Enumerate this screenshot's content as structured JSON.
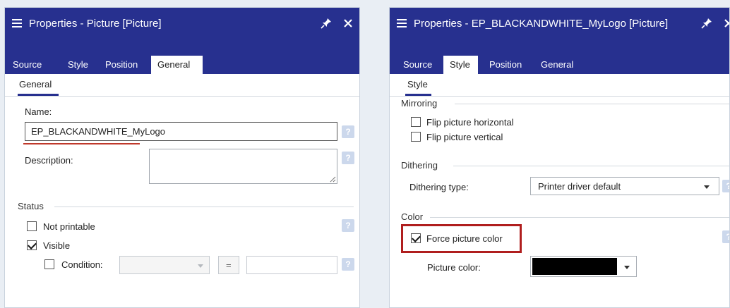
{
  "left_panel": {
    "title": "Properties - Picture [Picture]",
    "tabs": [
      "Source",
      "Style",
      "Position",
      "General"
    ],
    "active_tab": "General",
    "subtab": "General",
    "name_label": "Name:",
    "name_value": "EP_BLACKANDWHITE_MyLogo",
    "description_label": "Description:",
    "description_value": "",
    "status_section": "Status",
    "not_printable_label": "Not printable",
    "visible_label": "Visible",
    "condition_label": "Condition:",
    "condition_operator": "=",
    "condition_value": "",
    "help_glyph": "?"
  },
  "right_panel": {
    "title": "Properties - EP_BLACKANDWHITE_MyLogo [Picture]",
    "tabs": [
      "Source",
      "Style",
      "Position",
      "General"
    ],
    "active_tab": "Style",
    "subtab": "Style",
    "mirroring_section": "Mirroring",
    "flip_horizontal_label": "Flip picture horizontal",
    "flip_vertical_label": "Flip picture vertical",
    "dithering_section": "Dithering",
    "dithering_type_label": "Dithering type:",
    "dithering_type_value": "Printer driver default",
    "color_section": "Color",
    "force_color_label": "Force picture color",
    "picture_color_label": "Picture color:",
    "picture_color_value": "#000000",
    "help_glyph": "?"
  },
  "colors": {
    "titlebar": "#27308f",
    "highlight": "#b01e1e"
  },
  "icons": [
    "menu-icon",
    "pin-icon",
    "close-icon",
    "help-icon",
    "chevron-down-icon",
    "resize-grip-icon"
  ]
}
